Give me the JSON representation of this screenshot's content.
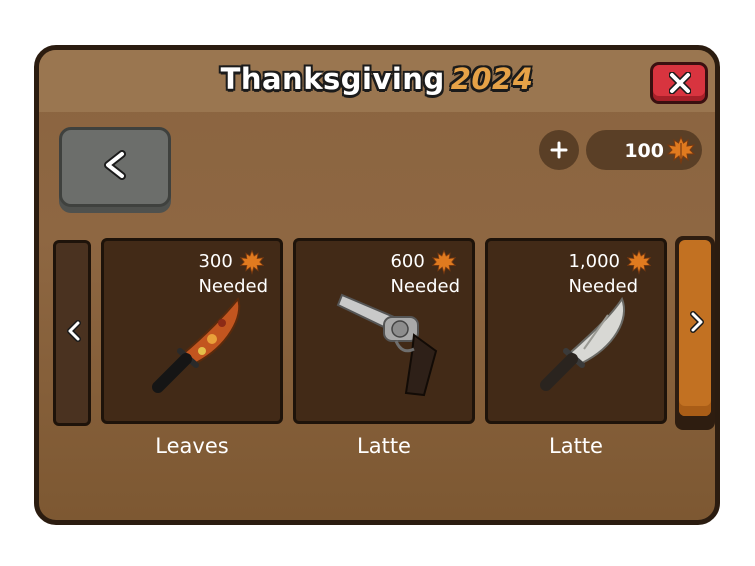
{
  "header": {
    "title": "Thanksgiving",
    "year": "2024"
  },
  "currency": {
    "amount": "100",
    "icon": "maple-leaf-icon"
  },
  "icons": {
    "close": "close-icon",
    "back": "chevron-left-icon",
    "plus": "plus-icon",
    "prev": "chevron-left-icon",
    "next": "chevron-right-icon"
  },
  "items": [
    {
      "cost": "300",
      "needed_label": "Needed",
      "name": "Leaves",
      "weapon": "knife"
    },
    {
      "cost": "600",
      "needed_label": "Needed",
      "name": "Latte",
      "weapon": "revolver"
    },
    {
      "cost": "1,000",
      "needed_label": "Needed",
      "name": "Latte",
      "weapon": "knife"
    }
  ],
  "colors": {
    "panel": "#8a6440",
    "close_button": "#d8343f",
    "next_arrow": "#c27122",
    "title_year": "#e6a247"
  }
}
